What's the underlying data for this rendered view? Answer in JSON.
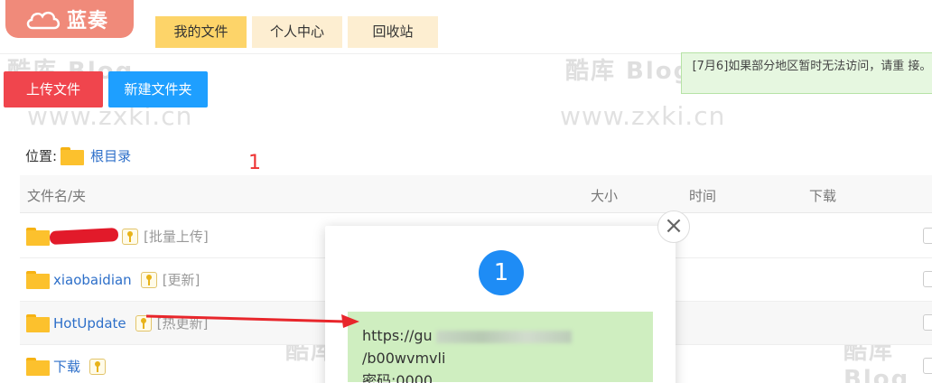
{
  "brand": {
    "logo_text": "蓝奏"
  },
  "nav": {
    "tabs": [
      "我的文件",
      "个人中心",
      "回收站"
    ],
    "active": 0
  },
  "actions": {
    "upload_label": "上传文件",
    "new_folder_label": "新建文件夹"
  },
  "notice": {
    "text": "[7月6]如果部分地区暂时无法访问，请重 接。"
  },
  "watermarks": {
    "logo": "酷库 Blog",
    "url": "www.zxki.cn"
  },
  "breadcrumb": {
    "label": "位置:",
    "root": "根目录"
  },
  "annotation_number": "1",
  "table": {
    "headers": {
      "name": "文件名/夹",
      "size": "大小",
      "time": "时间",
      "download": "下载"
    },
    "rows": [
      {
        "name": "",
        "tag": "[批量上传]",
        "redacted": true
      },
      {
        "name": "xiaobaidian",
        "tag": "[更新]"
      },
      {
        "name": "HotUpdate",
        "tag": "[热更新]"
      },
      {
        "name": "下载",
        "tag": ""
      }
    ]
  },
  "popup": {
    "badge": "1",
    "close_symbol": "×",
    "url_prefix": "https://gu",
    "url_suffix": "/b00wvmvli",
    "password": "密码:0000"
  },
  "colors": {
    "accent_red": "#f0454d",
    "accent_blue": "#1e9fff",
    "tab_active": "#fdd469",
    "tab_inactive": "#fdeed1",
    "link": "#2d6fc9"
  }
}
